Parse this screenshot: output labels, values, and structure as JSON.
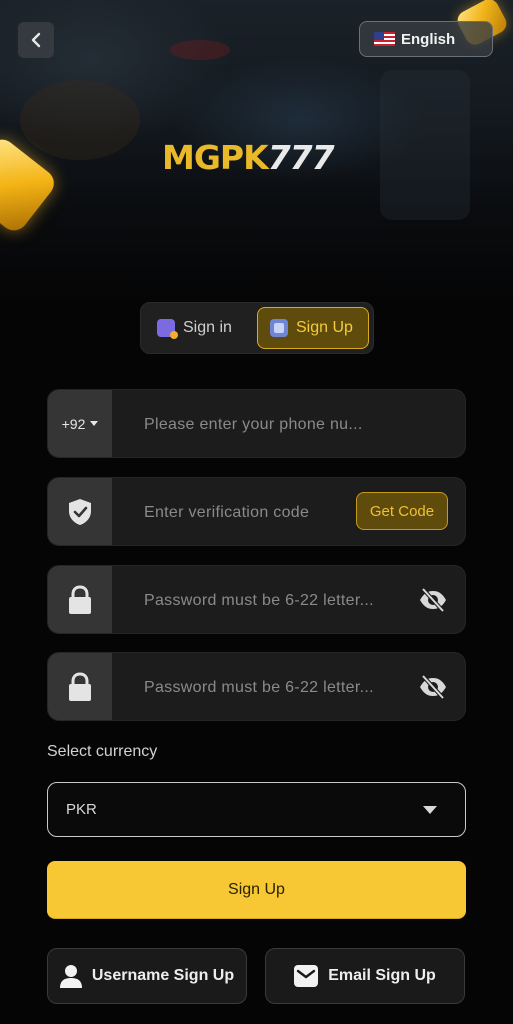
{
  "header": {
    "logo_primary": "MGPK",
    "logo_secondary": "777",
    "language_label": "English",
    "language_flag": "us-flag-icon"
  },
  "tabs": [
    {
      "label": "Sign in",
      "active": false
    },
    {
      "label": "Sign Up",
      "active": true
    }
  ],
  "form": {
    "country_code": "+92",
    "phone_placeholder": "Please enter your phone nu...",
    "verification_placeholder": "Enter verification code",
    "get_code_label": "Get Code",
    "password_placeholder": "Password must be 6-22 letter...",
    "confirm_password_placeholder": "Password must be 6-22 letter...",
    "currency_label": "Select currency",
    "currency_value": "PKR",
    "submit_label": "Sign Up"
  },
  "alternatives": {
    "username_label": "Username Sign Up",
    "email_label": "Email Sign Up"
  },
  "colors": {
    "accent": "#f7c834",
    "accent_dark": "#5f4c0d",
    "background": "#050505",
    "field_bg": "#1c1c1c"
  }
}
